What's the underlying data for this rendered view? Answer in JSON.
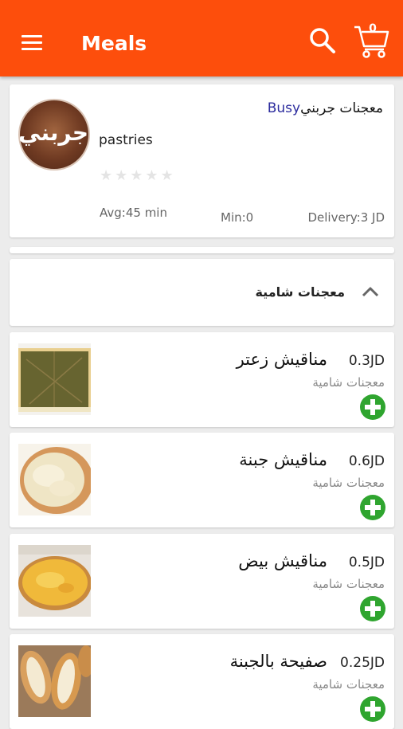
{
  "appbar": {
    "title": "Meals",
    "cart_count": "0"
  },
  "store": {
    "busy": "Busy",
    "name": "معجنات جربني",
    "logo_text": "جربني",
    "category": "pastries",
    "rating_stars": "★★★★★",
    "avg_time": "Avg:45 min",
    "min_order": "Min:0",
    "delivery": "Delivery:3 JD"
  },
  "section": {
    "title": "معجنات شامية"
  },
  "items": [
    {
      "name": "مناقيش زعتر",
      "price": "0.3JD",
      "category": "معجنات شامية"
    },
    {
      "name": "مناقيش جبنة",
      "price": "0.6JD",
      "category": "معجنات شامية"
    },
    {
      "name": "مناقيش بيض",
      "price": "0.5JD",
      "category": "معجنات شامية"
    },
    {
      "name": "صفيحة بالجبنة",
      "price": "0.25JD",
      "category": "معجنات شامية"
    }
  ],
  "colors": {
    "primary": "#fd4e0c",
    "add_green": "#2fa52f",
    "busy": "#2c2c9e"
  }
}
